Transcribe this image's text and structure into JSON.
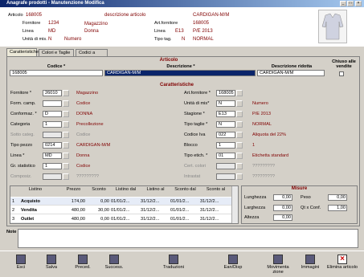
{
  "window": {
    "title": "Anagrafe prodotti - Manutenzione  Modifica"
  },
  "header": {
    "articolo_label": "Articolo",
    "articolo_value": "168005",
    "descrizione_label": "descrizione articolo",
    "descrizione_value": "CARDIGAN-M/M",
    "fornitore_label": "Fornitore",
    "fornitore_value": "1234",
    "magazzino_label": "Magazzino",
    "art_fornitore_label": "Art.fornitore",
    "art_fornitore_value": "168005",
    "linea_label": "Linea",
    "linea_value": "MD",
    "linea_desc": "Donna",
    "linea2_label": "Linea",
    "linea2_value": "E13",
    "linea2_desc": "P/E 2013",
    "unita_label": "Unità di mis.",
    "unita_value": "N",
    "unita_desc": "Numero",
    "tipo_tag_label": "Tipo tag.",
    "tipo_tag_value": "N",
    "tipo_tag_desc": "NORMAL"
  },
  "tabs": [
    {
      "label": "Caratteristiche"
    },
    {
      "label": "Colori e Taglie"
    },
    {
      "label": "Codici a barre"
    }
  ],
  "articolo": {
    "section_title": "Articolo",
    "codice_label": "Codice *",
    "codice_value": "168005",
    "descrizione_label": "Descrizione *",
    "descrizione_value": "CARDIGAN-M/M",
    "ridotta_label": "Descrizione ridotta",
    "ridotta_value": "CARDIGAN-M/M",
    "chiuso_label": "Chiuso alle vendite"
  },
  "caratteristiche": {
    "section_title": "Caratteristiche",
    "left": [
      {
        "label": "Fornitore *",
        "code": "26010",
        "desc": "Magazzino",
        "gray": false
      },
      {
        "label": "Form. camp.",
        "code": "",
        "desc": "Codice",
        "gray": false
      },
      {
        "label": "Conformaz. *",
        "code": "D",
        "desc": "DONNA",
        "gray": false
      },
      {
        "label": "Categoria",
        "code": "1",
        "desc": "Precollezione",
        "gray": false
      },
      {
        "label": "Sotto categ.",
        "code": "",
        "desc": "Codice",
        "gray": true
      },
      {
        "label": "Tipo pezzo",
        "code": "0214",
        "desc": "CARDIGAN-M/M",
        "gray": false
      },
      {
        "label": "Linea *",
        "code": "MD",
        "desc": "Donna",
        "gray": false
      },
      {
        "label": "Gr. statistico",
        "code": "1",
        "desc": "Codice",
        "gray": false
      },
      {
        "label": "Composiz.",
        "code": "",
        "desc": "?????????",
        "gray": true
      }
    ],
    "right": [
      {
        "label": "Art.fornitore *",
        "code": "168005",
        "desc": "",
        "gray": false
      },
      {
        "label": "Unità di mis*",
        "code": "N",
        "desc": "Numero",
        "gray": false
      },
      {
        "label": "Stagione *",
        "code": "E13",
        "desc": "P/E 2013",
        "gray": false
      },
      {
        "label": "Tipo taglie *",
        "code": "N",
        "desc": "NORMAL",
        "gray": false
      },
      {
        "label": "Codice Iva",
        "code": "022",
        "desc": "Aliquota del 22%",
        "gray": false
      },
      {
        "label": "Blocco",
        "code": "1",
        "desc": "1",
        "gray": false
      },
      {
        "label": "Tipo etich. *",
        "code": "01",
        "desc": "Etichetta standard",
        "gray": false
      },
      {
        "label": "Cert. colori",
        "code": "",
        "desc": "?????????",
        "gray": true
      },
      {
        "label": "Intrastat",
        "code": "",
        "desc": "?????????",
        "gray": true
      }
    ]
  },
  "listini": {
    "headers": [
      "Listino",
      "Prezzo",
      "Sconto",
      "Listino dal",
      "Listino al",
      "Sconto dal",
      "Sconto al"
    ],
    "rows": [
      {
        "num": "1",
        "listino": "Acquisto",
        "prezzo": "174,00",
        "sconto": "0,00",
        "listino_dal": "01/01/2...",
        "listino_al": "31/12/2...",
        "sconto_dal": "01/01/2...",
        "sconto_al": "31/12/2..."
      },
      {
        "num": "2",
        "listino": "Vendita",
        "prezzo": "480,00",
        "sconto": "30,00",
        "listino_dal": "01/01/2...",
        "listino_al": "31/12/2...",
        "sconto_dal": "01/01/2...",
        "sconto_al": "31/12/2..."
      },
      {
        "num": "3",
        "listino": "Outlet",
        "prezzo": "480,00",
        "sconto": "0,00",
        "listino_dal": "01/01/2...",
        "listino_al": "31/12/2...",
        "sconto_dal": "01/01/2...",
        "sconto_al": "31/12/2..."
      }
    ]
  },
  "misure": {
    "section_title": "Misure",
    "lunghezza_label": "Lunghezza",
    "lunghezza_value": "0,00",
    "peso_label": "Peso",
    "peso_value": "0,00",
    "larghezza_label": "Larghezza",
    "larghezza_value": "0,00",
    "qt_conf_label": "Qt x Conf.",
    "qt_conf_value": "1,00",
    "altezza_label": "Altezza",
    "altezza_value": "0,00"
  },
  "note": {
    "label": "Note"
  },
  "toolbar": {
    "esci": "Esci",
    "salva": "Salva",
    "preced": "Preced.",
    "success": "Success.",
    "traduzioni": "Traduzioni",
    "eanbar": "Ean/Disp",
    "movimentazione": "Movimenta zione",
    "immagini": "Immagini",
    "elimina": "Elimina articolo"
  }
}
